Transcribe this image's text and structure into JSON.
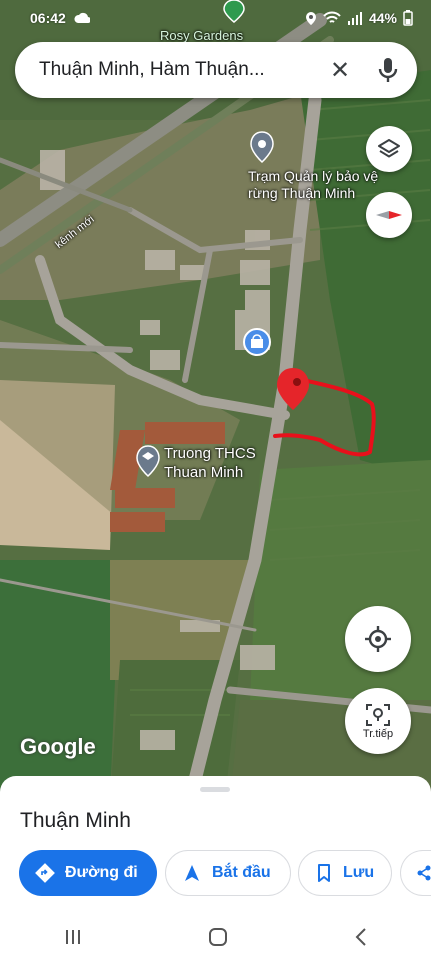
{
  "status_bar": {
    "time": "06:42",
    "battery": "44%"
  },
  "search": {
    "query": "Thuận Minh, Hàm Thuận..."
  },
  "map_labels": {
    "top_place": "Rosy Gardens",
    "station_line1": "Trạm Quản lý bảo vệ",
    "station_line2": "rừng Thuận Minh",
    "canal": "kênh mới",
    "school_line1": "Truong THCS",
    "school_line2": "Thuan Minh",
    "google": "Google",
    "street_view_label": "Tr.tiếp"
  },
  "place_sheet": {
    "name": "Thuận Minh",
    "directions_label": "Đường đi",
    "start_label": "Bắt đầu",
    "save_label": "Lưu"
  },
  "colors": {
    "accent": "#1a73e8",
    "pin": "#e5252a",
    "annotation": "#e8101b"
  }
}
